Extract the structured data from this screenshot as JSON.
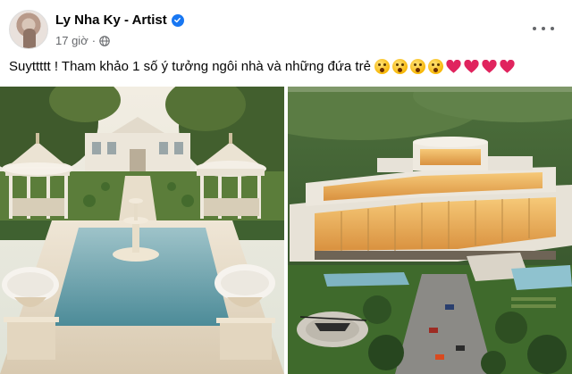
{
  "post": {
    "author": "Ly Nha Ky - Artist",
    "time": "17 giờ",
    "caption": "Suyttttt ! Tham khảo 1 số ý tưởng ngôi nhà và những đứa trẻ",
    "emojis": [
      "hushed-face",
      "hushed-face",
      "hushed-face",
      "hushed-face",
      "red-heart",
      "red-heart",
      "red-heart",
      "red-heart"
    ],
    "icons": {
      "verified": "verified-badge-icon",
      "audience": "globe-icon",
      "more": "more-options-icon"
    },
    "colors": {
      "verified": "#1877f2",
      "secondary_text": "#65676b",
      "heart": "#e0245e"
    }
  },
  "images": [
    {
      "subject": "classical-garden-estate-with-fountain-and-gazebos"
    },
    {
      "subject": "modern-hillside-mansion-with-helipad"
    }
  ]
}
